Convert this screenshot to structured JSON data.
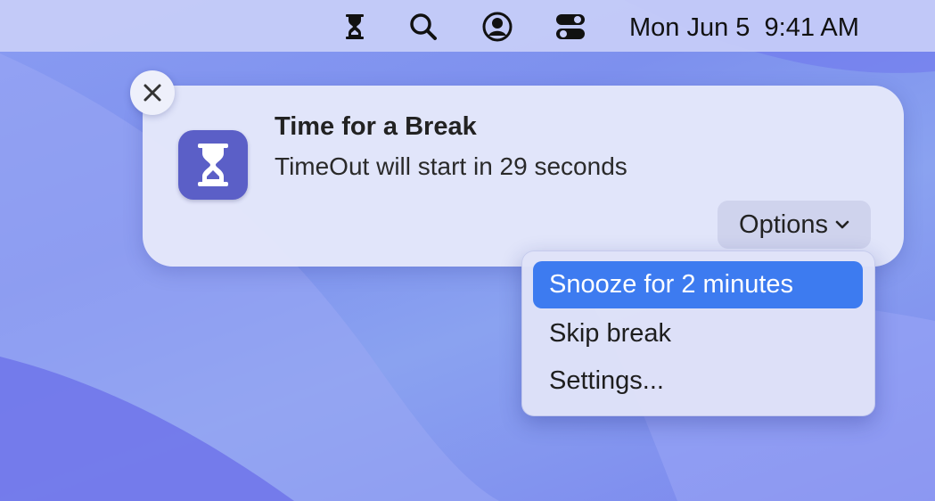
{
  "menubar": {
    "icons": [
      "hourglass-icon",
      "search-icon",
      "user-account-icon",
      "control-center-icon"
    ],
    "clock": "Mon Jun 5  9:41 AM"
  },
  "notification": {
    "app_icon": "hourglass-icon",
    "title": "Time for a Break",
    "body": "TimeOut will start in 29 seconds",
    "options_label": "Options",
    "close_icon": "close-icon"
  },
  "menu": {
    "items": [
      {
        "label": "Snooze for 2 minutes",
        "selected": true
      },
      {
        "label": "Skip break",
        "selected": false
      },
      {
        "label": "Settings...",
        "selected": false
      }
    ]
  },
  "colors": {
    "accent": "#3d7bf0",
    "app_icon_bg": "#5b5fc7"
  }
}
